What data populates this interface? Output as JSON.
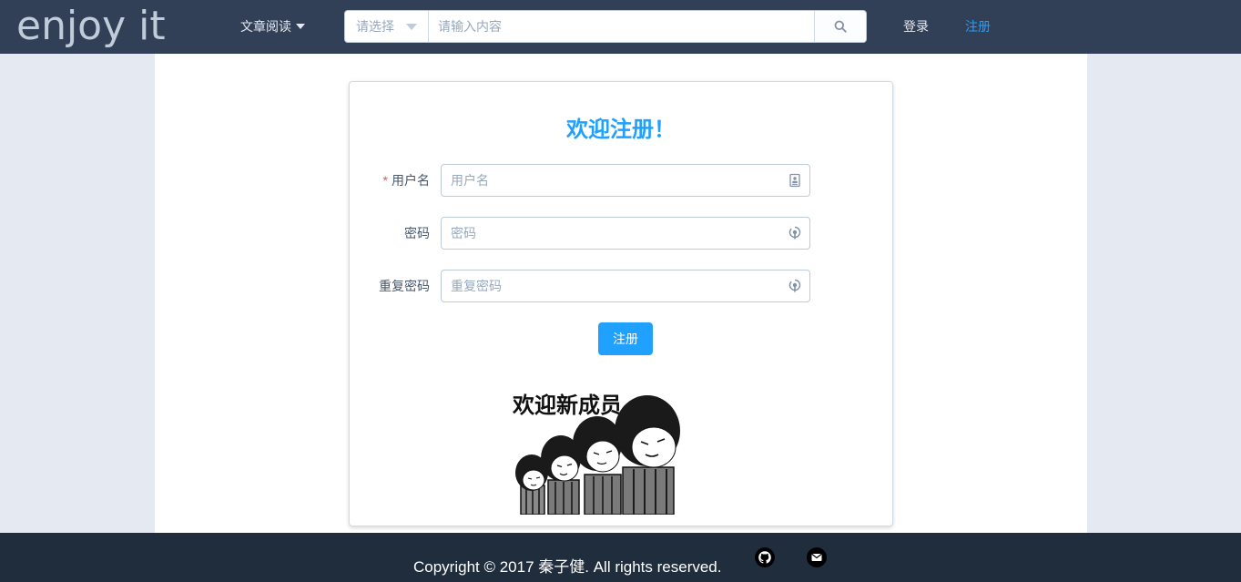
{
  "header": {
    "logo": "enjoy it",
    "nav_read": "文章阅读",
    "search": {
      "select_placeholder": "请选择",
      "input_placeholder": "请输入内容"
    },
    "login": "登录",
    "register": "注册"
  },
  "form": {
    "title": "欢迎注册！",
    "required_mark": "*",
    "fields": [
      {
        "label": "用户名",
        "placeholder": "用户名",
        "value": "",
        "icon": "id-card-icon"
      },
      {
        "label": "密码",
        "placeholder": "密码",
        "value": "",
        "icon": "password-lock-icon"
      },
      {
        "label": "重复密码",
        "placeholder": "重复密码",
        "value": "",
        "icon": "password-lock-icon"
      }
    ],
    "submit": "注册",
    "meme_caption": "欢迎新成员"
  },
  "footer": {
    "copyright": "Copyright © 2017 秦子健. All rights reserved.",
    "icons": [
      "github-icon",
      "mail-icon"
    ]
  },
  "colors": {
    "header_bg": "#324057",
    "accent": "#20a0ff",
    "footer_bg": "#1f2d3d",
    "page_bg": "#e5e9f2"
  }
}
